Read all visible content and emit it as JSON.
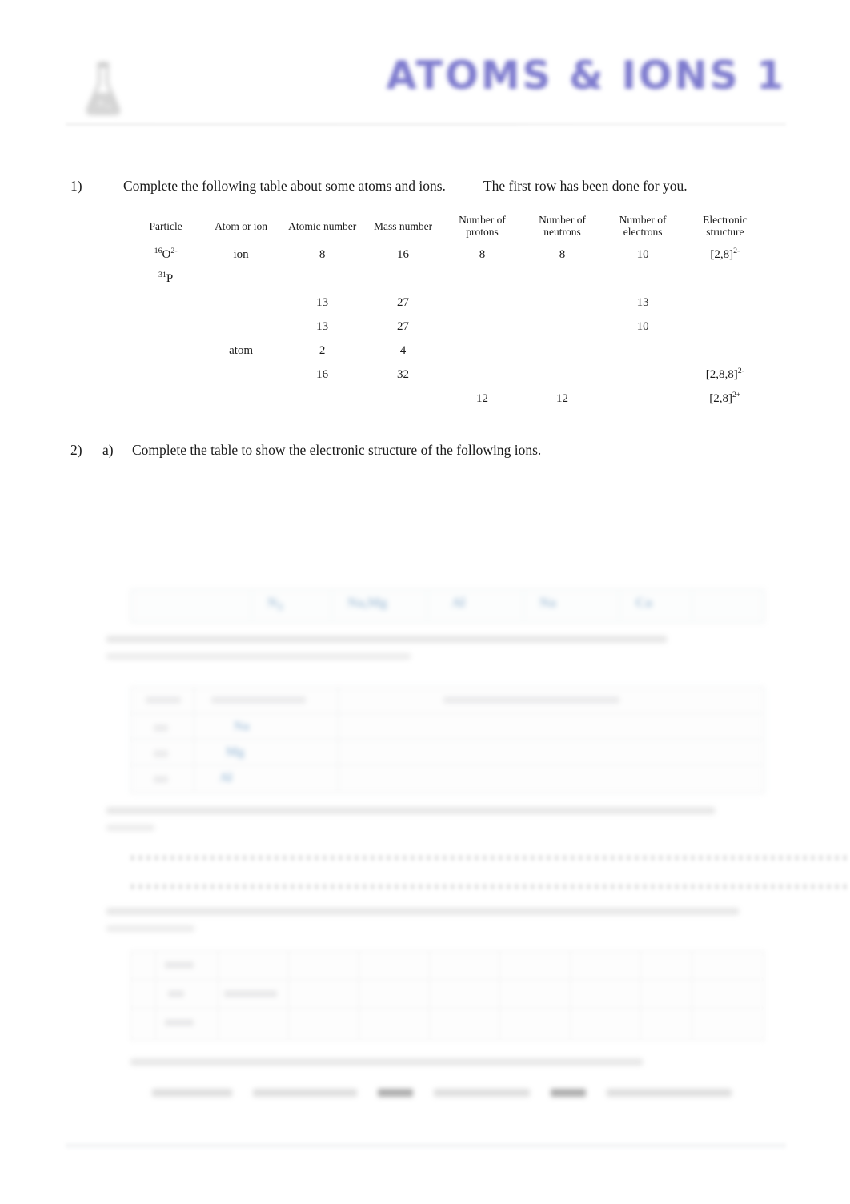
{
  "document": {
    "title": "ATOMS & IONS 1",
    "title_color": "#7d7ace",
    "logo_icon": "flask-logo-icon"
  },
  "question1": {
    "number": "1)",
    "text": "Complete the following table about some atoms and ions.",
    "note": "The first row has been done for you.",
    "table": {
      "headers": [
        "Particle",
        "Atom or ion",
        "Atomic number",
        "Mass number",
        "Number of protons",
        "Number of neutrons",
        "Number of electrons",
        "Electronic structure"
      ],
      "rows": [
        {
          "particle_mass": "16",
          "particle_symbol": "O",
          "particle_charge": "2-",
          "atom_or_ion": "ion",
          "atomic_number": "8",
          "mass_number": "16",
          "protons": "8",
          "neutrons": "8",
          "electrons": "10",
          "electronic_structure": "[2,8]",
          "electronic_structure_charge": "2-"
        },
        {
          "particle_mass": "31",
          "particle_symbol": "P",
          "particle_charge": "",
          "atom_or_ion": "",
          "atomic_number": "",
          "mass_number": "",
          "protons": "",
          "neutrons": "",
          "electrons": "",
          "electronic_structure": "",
          "electronic_structure_charge": ""
        },
        {
          "particle_mass": "",
          "particle_symbol": "",
          "particle_charge": "",
          "atom_or_ion": "",
          "atomic_number": "13",
          "mass_number": "27",
          "protons": "",
          "neutrons": "",
          "electrons": "13",
          "electronic_structure": "",
          "electronic_structure_charge": ""
        },
        {
          "particle_mass": "",
          "particle_symbol": "",
          "particle_charge": "",
          "atom_or_ion": "",
          "atomic_number": "13",
          "mass_number": "27",
          "protons": "",
          "neutrons": "",
          "electrons": "10",
          "electronic_structure": "",
          "electronic_structure_charge": ""
        },
        {
          "particle_mass": "",
          "particle_symbol": "",
          "particle_charge": "",
          "atom_or_ion": "atom",
          "atomic_number": "2",
          "mass_number": "4",
          "protons": "",
          "neutrons": "",
          "electrons": "",
          "electronic_structure": "",
          "electronic_structure_charge": ""
        },
        {
          "particle_mass": "",
          "particle_symbol": "",
          "particle_charge": "",
          "atom_or_ion": "",
          "atomic_number": "16",
          "mass_number": "32",
          "protons": "",
          "neutrons": "",
          "electrons": "",
          "electronic_structure": "[2,8,8]",
          "electronic_structure_charge": "2-"
        },
        {
          "particle_mass": "",
          "particle_symbol": "",
          "particle_charge": "",
          "atom_or_ion": "",
          "atomic_number": "",
          "mass_number": "",
          "protons": "12",
          "neutrons": "12",
          "electrons": "",
          "electronic_structure": "[2,8]",
          "electronic_structure_charge": "2+"
        }
      ]
    }
  },
  "question2": {
    "number": "2)",
    "sub": "a)",
    "text": "Complete the table to show the electronic structure of the following ions."
  },
  "obscured": {
    "note": "Lower portion of the page is blurred and unreadable in the source image.",
    "electronic_structure_row_label": "",
    "blue_symbols": [
      "",
      "",
      "",
      "",
      ""
    ]
  }
}
